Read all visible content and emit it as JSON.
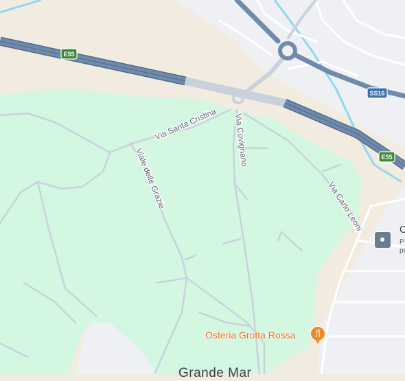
{
  "roads": {
    "via_santa_cristina": "Via Santa Cristina",
    "via_covignano": "Via Covignano",
    "viale_delle_grazie": "Viale delle Grazie",
    "via_carlo_leoni": "Via Carlo Leoni"
  },
  "shields": {
    "e55_west": "E55",
    "e55_east": "E55",
    "ss16": "SS16"
  },
  "poi": {
    "name": "Osteria Grotta Rossa",
    "icon": "restaurant-fork-knife-icon"
  },
  "edge_place": {
    "initial": "O",
    "line1": "P",
    "line2": "pe",
    "icon": "transit-stop-icon"
  },
  "town_partial": "Grande Mar",
  "colors": {
    "land": "#f2ece0",
    "park": "#d4f7e2",
    "urban": "#eef0f3",
    "motorway": "#6f8aab",
    "road": "#c9d2dc",
    "water": "#8fd8ef",
    "poi": "#f08a24"
  }
}
